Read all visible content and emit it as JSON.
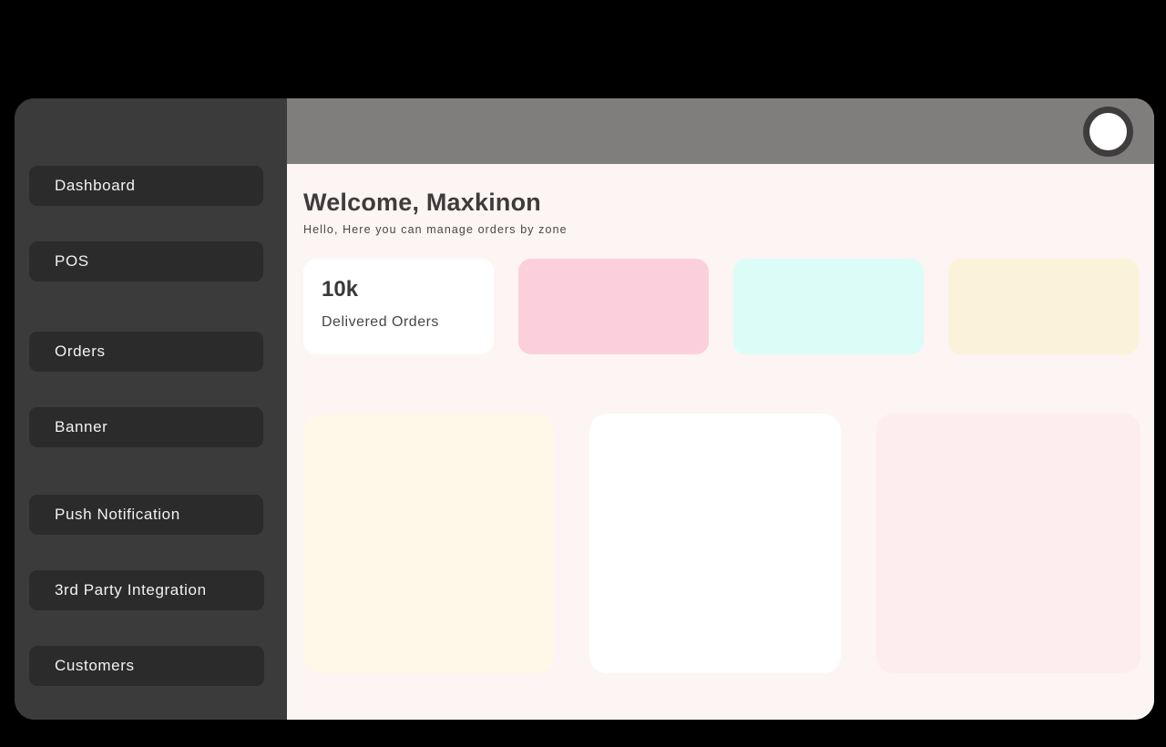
{
  "window": {
    "background_color": "#000000",
    "shell_color": "#3b3b3b"
  },
  "sidebar": {
    "background_color": "#3b3b3b",
    "item_color": "#2b2b2b",
    "items": [
      {
        "label": "Dashboard"
      },
      {
        "label": "POS"
      },
      {
        "label": "Orders"
      },
      {
        "label": "Banner"
      },
      {
        "label": "Push Notification"
      },
      {
        "label": "3rd Party Integration"
      },
      {
        "label": "Customers"
      }
    ]
  },
  "topbar": {
    "background_color": "#807d7d",
    "avatar": {
      "icon": "user-avatar-circle",
      "fill_color": "#ffffff",
      "ring_color": "#3e3c3c"
    }
  },
  "main": {
    "background_color": "#fdf4f4",
    "welcome": {
      "title": "Welcome, Maxkinon",
      "subtitle": "Hello, Here you can manage orders by zone"
    },
    "stat_cards": [
      {
        "value": "10k",
        "label": "Delivered Orders",
        "background_color": "#ffffff"
      },
      {
        "value": "",
        "label": "",
        "background_color": "#fbd0dc"
      },
      {
        "value": "",
        "label": "",
        "background_color": "#dcfdf7"
      },
      {
        "value": "",
        "label": "",
        "background_color": "#fbf2da"
      }
    ],
    "panels": [
      {
        "title": "",
        "background_color": "#fdf8e7"
      },
      {
        "title": "",
        "background_color": "#ffffff"
      },
      {
        "title": "",
        "background_color": "#fdedee"
      }
    ]
  }
}
